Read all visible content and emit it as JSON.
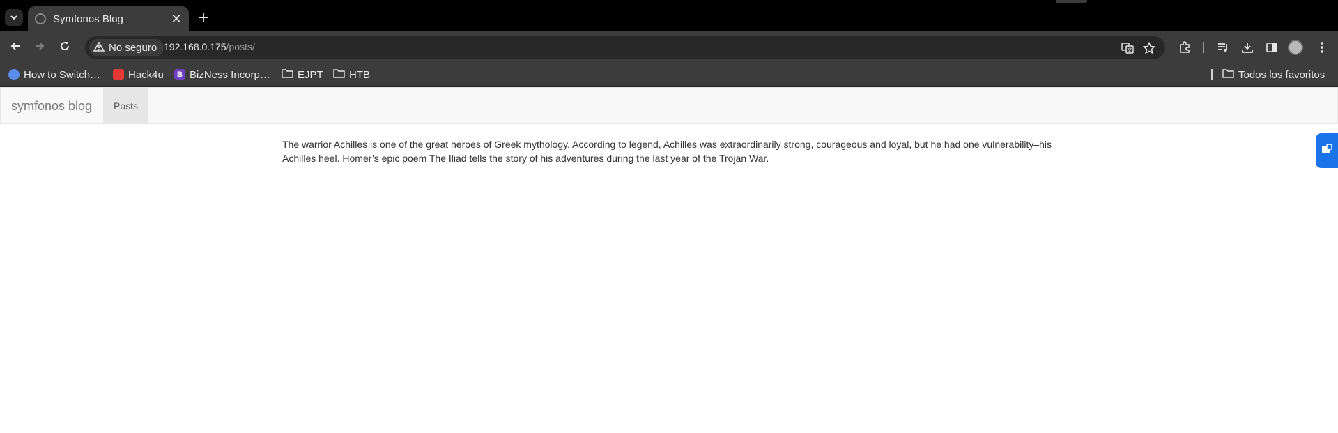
{
  "browser": {
    "tab": {
      "title": "Symfonos Blog",
      "close_glyph": "✕",
      "favicon": "globe-icon"
    },
    "new_tab_glyph": "+",
    "address": {
      "security_label": "No seguro",
      "url_host": "192.168.0.175",
      "url_path": "/posts/"
    },
    "bookmarks": [
      {
        "label": "How to Switch…",
        "icon": "site-favicon",
        "color": "#5b8def"
      },
      {
        "label": "Hack4u",
        "icon": "hack4u-favicon",
        "color": "#e53935"
      },
      {
        "label": "BizNess Incorp…",
        "icon": "bizness-favicon",
        "letter": "B",
        "color": "#6f42c1"
      },
      {
        "label": "EJPT",
        "icon": "folder-icon"
      },
      {
        "label": "HTB",
        "icon": "folder-icon"
      }
    ],
    "all_bookmarks_label": "Todos los favoritos"
  },
  "site": {
    "brand": "symfonos blog",
    "nav_posts": "Posts",
    "post_text": "The warrior Achilles is one of the great heroes of Greek mythology. According to legend, Achilles was extraordinarily strong, courageous and loyal, but he had one vulnerability–his Achilles heel. Homer’s epic poem The Iliad tells the story of his adventures during the last year of the Trojan War."
  },
  "colors": {
    "tab_strip": "#000000",
    "toolbar": "#3c3c3c",
    "navbar_bg": "#f8f8f8",
    "widget_blue": "#1a73e8"
  }
}
